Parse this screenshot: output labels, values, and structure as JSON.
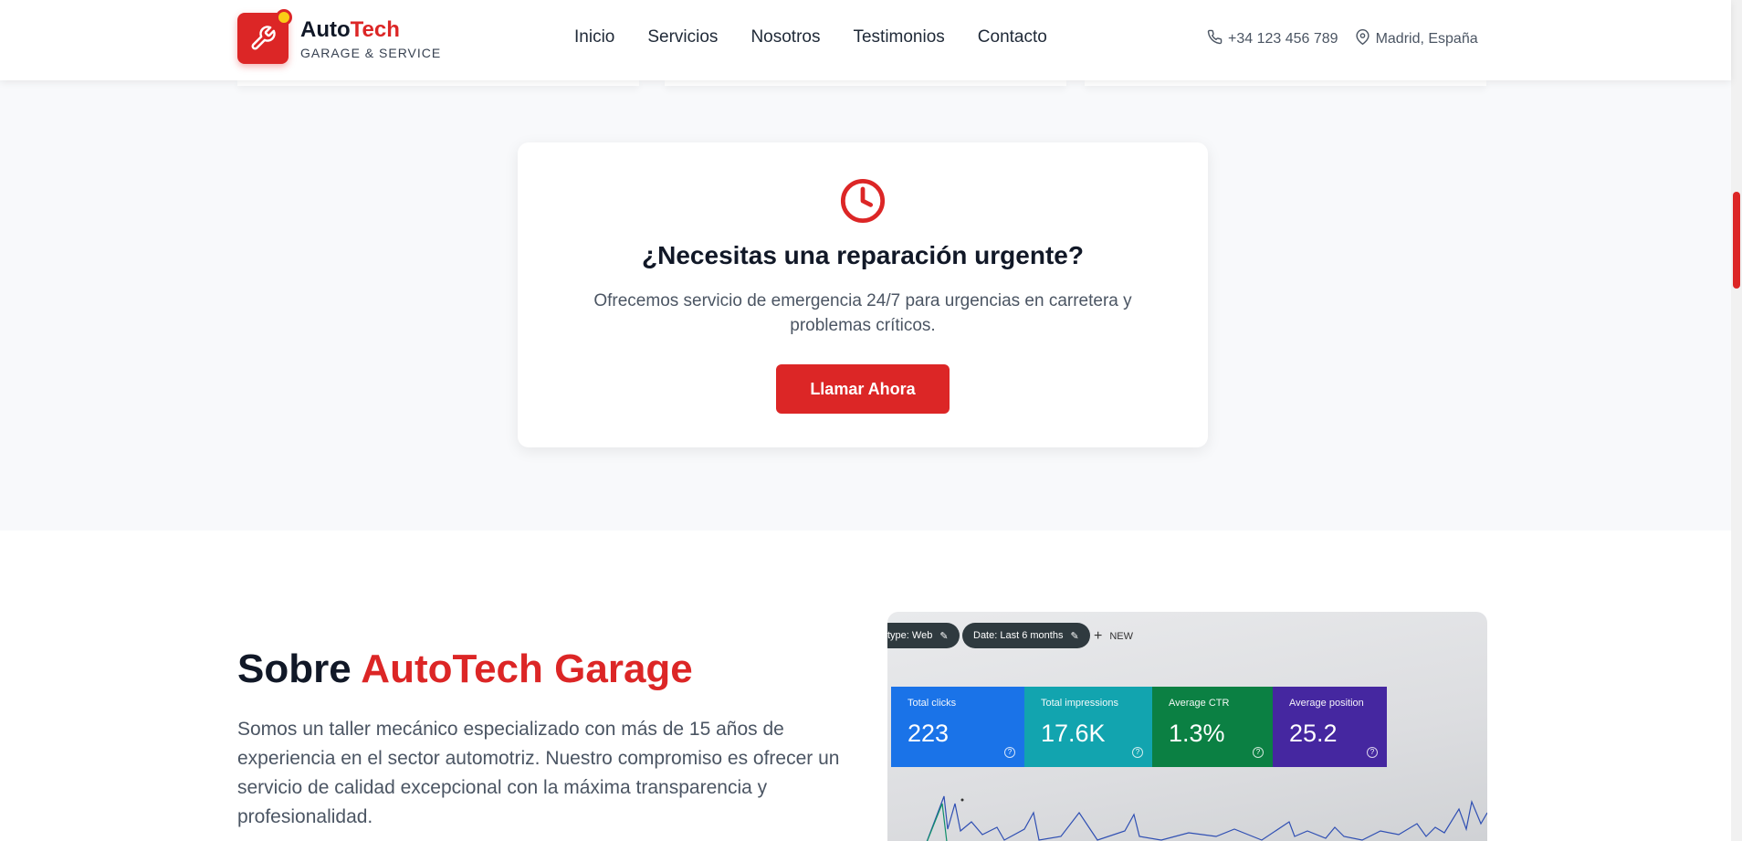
{
  "header": {
    "brand_name_part1": "Auto",
    "brand_name_part2": "Tech",
    "brand_sub": "GARAGE & SERVICE",
    "nav": [
      "Inicio",
      "Servicios",
      "Nosotros",
      "Testimonios",
      "Contacto"
    ],
    "phone": "+34 123 456 789",
    "location": "Madrid, España"
  },
  "urgent": {
    "title": "¿Necesitas una reparación urgente?",
    "text": "Ofrecemos servicio de emergencia 24/7 para urgencias en carretera y problemas críticos.",
    "button": "Llamar Ahora"
  },
  "about": {
    "title_part1": "Sobre ",
    "title_part2": "AutoTech Garage",
    "text": "Somos un taller mecánico especializado con más de 15 años de experiencia en el sector automotriz. Nuestro compromiso es ofrecer un servicio de calidad excepcional con la máxima transparencia y profesionalidad."
  },
  "photo": {
    "chip_type": "type: Web",
    "chip_date": "Date: Last 6 months",
    "new_label": "NEW",
    "metrics": [
      {
        "label": "Total clicks",
        "value": "223",
        "color": "#1a73e8"
      },
      {
        "label": "Total impressions",
        "value": "17.6K",
        "color": "#12a4af"
      },
      {
        "label": "Average CTR",
        "value": "1.3%",
        "color": "#0b8043"
      },
      {
        "label": "Average position",
        "value": "25.2",
        "color": "#4527a0"
      }
    ]
  },
  "colors": {
    "accent": "#dc2626",
    "text_dark": "#111827",
    "text_muted": "#4b5563",
    "band_bg": "#f8f9fb"
  }
}
